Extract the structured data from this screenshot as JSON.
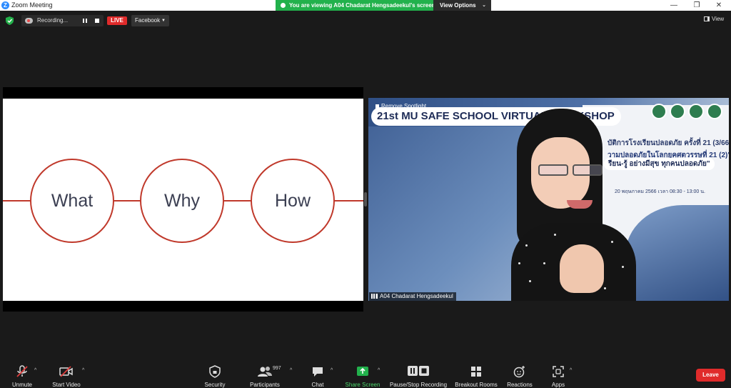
{
  "window": {
    "title": "Zoom Meeting",
    "controls": {
      "minimize": "—",
      "maximize": "❐",
      "close": "✕"
    }
  },
  "banner": {
    "viewing_text": "You are viewing A04 Chadarat Hengsadeekul's screen",
    "view_options_label": "View Options"
  },
  "topbar": {
    "recording_label": "Recording...",
    "live_label": "LIVE",
    "stream_target": "Facebook",
    "view_label": "View"
  },
  "slide": {
    "circles": [
      "What",
      "Why",
      "How"
    ],
    "accent_color": "#c0392b"
  },
  "video": {
    "remove_spotlight": "Remove Spotlight",
    "banner_title": "21st MU SAFE SCHOOL VIRTUAL WORKSHOP",
    "thai_line1": "บัติการโรงเรียนปลอดภัย ครั้งที่ 21 (3/66)",
    "thai_line2": "วามปลอดภัยในโลกยุคศตวรรษที่ 21 (2)\"",
    "thai_line3": "รียน-รู้ อย่างมีสุข ทุกคนปลอดภัย\"",
    "thai_line4": "20 พฤษภาคม 2566 เวลา 08:30 - 13:00 น.",
    "participant_name": "A04 Chadarat Hengsadeekul"
  },
  "toolbar": {
    "unmute": "Unmute",
    "start_video": "Start Video",
    "security": "Security",
    "participants": "Participants",
    "participant_count": "997",
    "chat": "Chat",
    "share_screen": "Share Screen",
    "pause_stop_recording": "Pause/Stop Recording",
    "breakout_rooms": "Breakout Rooms",
    "reactions": "Reactions",
    "apps": "Apps",
    "leave": "Leave"
  },
  "icons": {
    "mic": "mic-muted-icon",
    "video": "video-off-icon",
    "security": "shield-icon",
    "participants": "people-icon",
    "chat": "chat-bubble-icon",
    "share": "share-arrow-icon",
    "recording": "pause-stop-icon",
    "breakout": "grid-icon",
    "reactions": "smiley-icon",
    "apps": "apps-icon"
  },
  "colors": {
    "share_green": "#22b14c",
    "leave_red": "#e02b2b",
    "live_red": "#e02b2b",
    "toolbar_bg": "#1a1a1a"
  }
}
